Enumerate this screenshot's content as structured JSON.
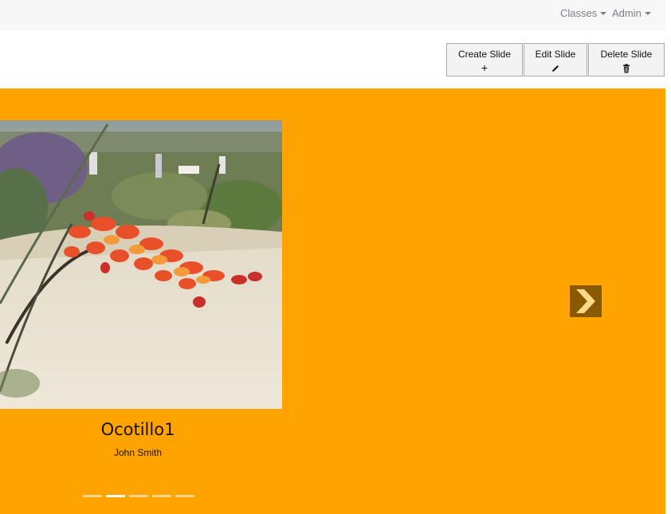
{
  "navbar": {
    "items": [
      {
        "label": "Classes"
      },
      {
        "label": "Admin"
      }
    ]
  },
  "toolbar": {
    "create": {
      "label": "Create Slide",
      "icon": "plus-icon",
      "glyph": "+"
    },
    "edit": {
      "label": "Edit Slide",
      "icon": "pencil-icon"
    },
    "delete": {
      "label": "Delete Slide",
      "icon": "trash-icon"
    }
  },
  "carousel": {
    "background": "#ffa300",
    "slide": {
      "title": "Ocotillo1",
      "author": "John Smith",
      "image": "ocotillo-flower-photo"
    },
    "indicator_count": 5,
    "active_indicator": 1
  }
}
